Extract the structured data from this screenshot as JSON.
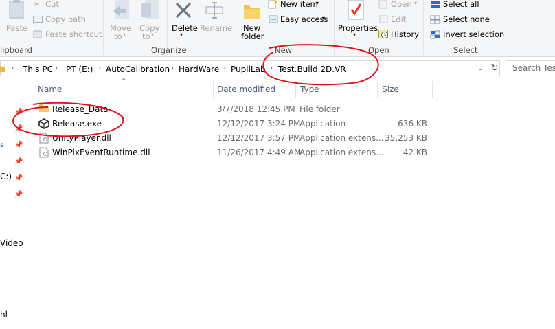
{
  "ribbon": {
    "clipboard": {
      "paste": "Paste",
      "cut": "Cut",
      "copy_path": "Copy path",
      "paste_shortcut": "Paste shortcut",
      "group": "lipboard"
    },
    "organize": {
      "move_to_1": "Move",
      "move_to_2": "to",
      "copy_to_1": "Copy",
      "copy_to_2": "to",
      "delete": "Delete",
      "rename": "Rename",
      "group": "Organize"
    },
    "new": {
      "new_folder_1": "New",
      "new_folder_2": "folder",
      "new_item": "New item",
      "easy_access": "Easy access",
      "group": "New"
    },
    "open": {
      "properties": "Properties",
      "open": "Open",
      "edit": "Edit",
      "history": "History",
      "group": "Open"
    },
    "select": {
      "select_all": "Select all",
      "select_none": "Select none",
      "invert_selection": "Invert selection",
      "group": "Select"
    }
  },
  "address": {
    "crumbs": [
      "This PC",
      "PT (E:)",
      "AutoCalibration",
      "HardWare",
      "PupilLab",
      "Test.Build.2D.VR"
    ],
    "search_placeholder": "Search Test..."
  },
  "columns": {
    "name": "Name",
    "date": "Date modified",
    "type": "Type",
    "size": "Size"
  },
  "files": [
    {
      "name": "Release_Data",
      "date": "3/7/2018 12:45 PM",
      "type": "File folder",
      "size": "",
      "icon": "folder-icon"
    },
    {
      "name": "Release.exe",
      "date": "12/12/2017 3:24 PM",
      "type": "Application",
      "size": "636 KB",
      "icon": "unity-icon"
    },
    {
      "name": "UnityPlayer.dll",
      "date": "12/12/2017 3:57 PM",
      "type": "Application extens...",
      "size": "35,253 KB",
      "icon": "dll-icon"
    },
    {
      "name": "WinPixEventRuntime.dll",
      "date": "11/26/2017 4:49 AM",
      "type": "Application extens...",
      "size": "42 KB",
      "icon": "dll-icon"
    }
  ],
  "nav_fragments": [
    "C:)",
    "Video",
    "hl"
  ],
  "colors": {
    "annotation": "#e0141c",
    "folder": "#e8b84a",
    "select_blue": "#2d6cc0"
  }
}
